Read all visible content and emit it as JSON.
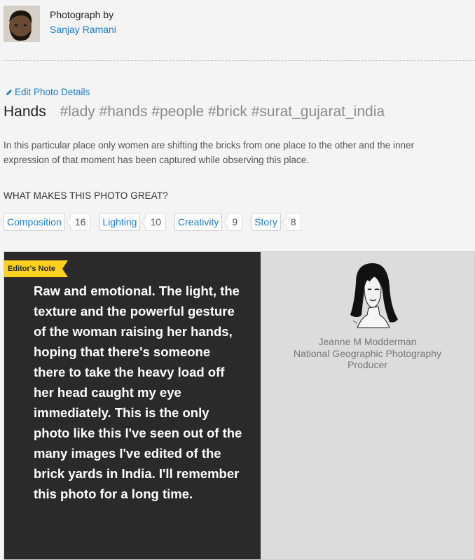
{
  "author": {
    "caption": "Photograph by",
    "name": "Sanjay Ramani"
  },
  "edit_link": "Edit Photo Details",
  "photo": {
    "title": "Hands",
    "tags": "#lady #hands #people #brick #surat_gujarat_india",
    "description": "In this particular place only women are shifting the bricks from one place to the other and the inner expression of that moment has been captured while observing this place."
  },
  "great": {
    "heading": "WHAT MAKES THIS PHOTO GREAT?",
    "votes": [
      {
        "label": "Composition",
        "count": "16"
      },
      {
        "label": "Lighting",
        "count": "10"
      },
      {
        "label": "Creativity",
        "count": "9"
      },
      {
        "label": "Story",
        "count": "8"
      }
    ]
  },
  "editor_note": {
    "badge": "Editor's Note",
    "text": "Raw and emotional. The light, the texture and the powerful gesture of the woman raising her hands, hoping that there's someone there to take the heavy load off her head caught my eye immediately. This is the only photo like this I've seen out of the many images I've edited of the brick yards in India. I'll remember this photo for a long time.",
    "editor_name": "Jeanne M Modderman",
    "editor_title_line1": "National Geographic Photography",
    "editor_title_line2": "Producer"
  },
  "colors": {
    "link": "#1a7cc2",
    "badge": "#ffd21f",
    "panel_dark": "#2a2a2a",
    "panel_light": "#dcdcdc"
  }
}
